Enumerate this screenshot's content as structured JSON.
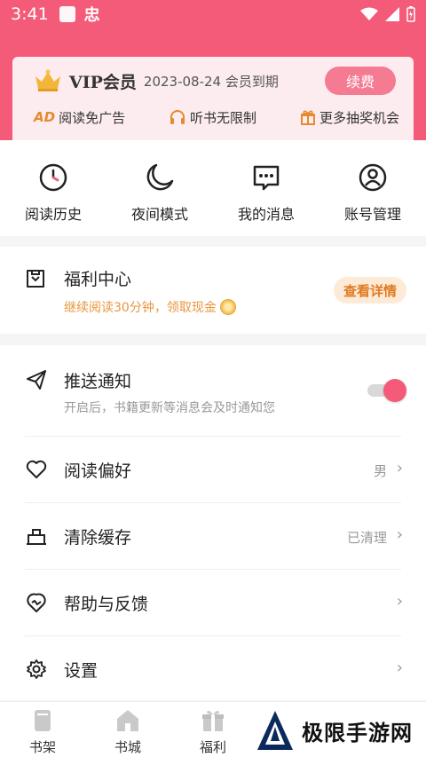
{
  "status_bar": {
    "time": "3:41",
    "app_glyph": "忠"
  },
  "vip": {
    "title": "VIP会员",
    "expiry": "2023-08-24 会员到期",
    "renew_label": "续费",
    "perks": [
      {
        "badge": "AD",
        "label": "阅读免广告",
        "icon": "ad-icon"
      },
      {
        "label": "听书无限制",
        "icon": "headphones-icon"
      },
      {
        "label": "更多抽奖机会",
        "icon": "gift-icon"
      }
    ]
  },
  "quick_actions": [
    {
      "label": "阅读历史",
      "icon": "clock-icon"
    },
    {
      "label": "夜间模式",
      "icon": "moon-icon"
    },
    {
      "label": "我的消息",
      "icon": "message-icon"
    },
    {
      "label": "账号管理",
      "icon": "user-icon"
    }
  ],
  "welfare": {
    "title": "福利中心",
    "subtitle": "继续阅读30分钟，领取现金",
    "button": "查看详情"
  },
  "settings": {
    "push": {
      "label": "推送通知",
      "sub": "开启后，书籍更新等消息会及时通知您",
      "enabled": true
    },
    "reading_pref": {
      "label": "阅读偏好",
      "value": "男"
    },
    "clear_cache": {
      "label": "清除缓存",
      "value": "已清理"
    },
    "help": {
      "label": "帮助与反馈"
    },
    "settings": {
      "label": "设置"
    }
  },
  "tabbar": [
    {
      "label": "书架",
      "icon": "bookshelf-icon"
    },
    {
      "label": "书城",
      "icon": "store-icon"
    },
    {
      "label": "福利",
      "icon": "gift-icon"
    },
    {
      "label": "",
      "icon": "tab4-icon"
    },
    {
      "label": "",
      "icon": "tab5-icon"
    }
  ],
  "watermark": {
    "text": "极限手游网"
  },
  "colors": {
    "accent": "#f35b78",
    "welfare_orange": "#e8963e"
  }
}
